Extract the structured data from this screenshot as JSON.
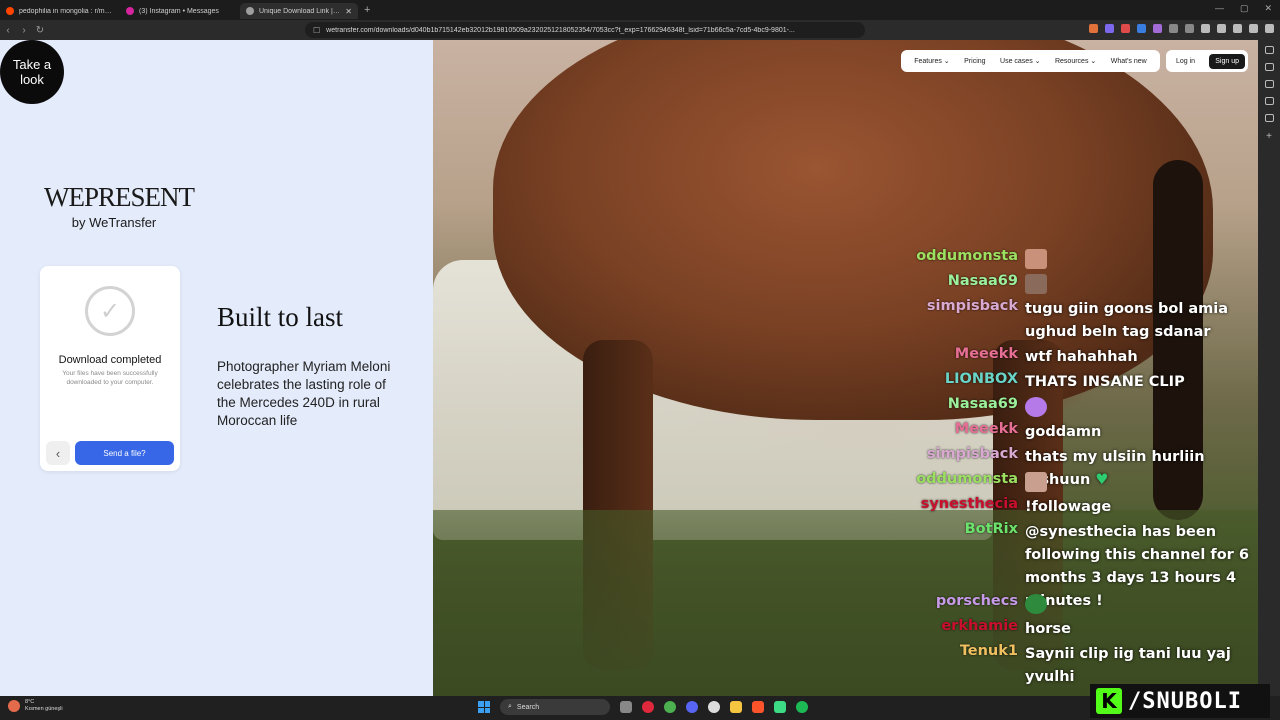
{
  "browser": {
    "tabs": [
      {
        "title": "pedophilia in mongolia : r/mongolia",
        "icon": "reddit-icon",
        "color": "#ff4500"
      },
      {
        "title": "(3) Instagram • Messages",
        "icon": "instagram-icon",
        "color": "#d6249f"
      },
      {
        "title": "Unique Download Link | WeTransfer",
        "icon": "wetransfer-icon",
        "color": "#9e9e9e"
      }
    ],
    "url": "wetransfer.com/downloads/d040b1b715142eb32012b19810509a2320251218052354/7053cc?t_exp=17662946348t_lsid=71b66c5a-7cd5-4bc9-9801-..."
  },
  "page": {
    "take_look": "Take a look",
    "wepresent_logo": "WEPRESENT",
    "wepresent_by": "by WeTransfer",
    "download_title": "Download completed",
    "download_sub": "Your files have been successfully downloaded to your computer.",
    "send_button": "Send a file?",
    "article_title": "Built to last",
    "article_text": "Photographer Myriam Meloni celebrates the lasting role of the Mercedes 240D in rural Moroccan life",
    "nav": [
      "Features",
      "Pricing",
      "Use cases",
      "Resources",
      "What's new"
    ],
    "login": "Log in",
    "signup": "Sign up"
  },
  "chat": [
    {
      "user": "oddumonsta",
      "color": "#9be060",
      "text": ""
    },
    {
      "user": "Nasaa69",
      "color": "#9bf09b",
      "text": ""
    },
    {
      "user": "simpisback",
      "color": "#d9a9d2",
      "text": "tugu giin goons bol amia ughud beln tag sdanar"
    },
    {
      "user": "Meeekk",
      "color": "#e76f96",
      "text": "wtf hahahhah"
    },
    {
      "user": "LIONBOX",
      "color": "#69d4c8",
      "text": "THATS INSANE CLIP"
    },
    {
      "user": "Nasaa69",
      "color": "#9bf09b",
      "text": ""
    },
    {
      "user": "Meeekk",
      "color": "#e76f96",
      "text": "goddamn"
    },
    {
      "user": "simpisback",
      "color": "#d9a9d2",
      "text": "thats my ulsiin hurliin gishuun"
    },
    {
      "user": "oddumonsta",
      "color": "#9be060",
      "text": ""
    },
    {
      "user": "synesthecia",
      "color": "#c8102e",
      "text": "!followage"
    },
    {
      "user": "BotRix",
      "color": "#6ce36c",
      "text": "@synesthecia has been following this channel for 6 months 3 days 13 hours 4 minutes !"
    },
    {
      "user": "porschecs",
      "color": "#c79ae8",
      "text": ""
    },
    {
      "user": "erkhamie",
      "color": "#c8102e",
      "text": "horse"
    },
    {
      "user": "Tenuk1",
      "color": "#f0c060",
      "text": "Saynii clip iig tani luu yaj yvulhi"
    }
  ],
  "taskbar": {
    "weather_temp": "8°C",
    "weather_desc": "Kısmen güneşli",
    "search": "Search"
  },
  "brand": "/SNUBOLI"
}
